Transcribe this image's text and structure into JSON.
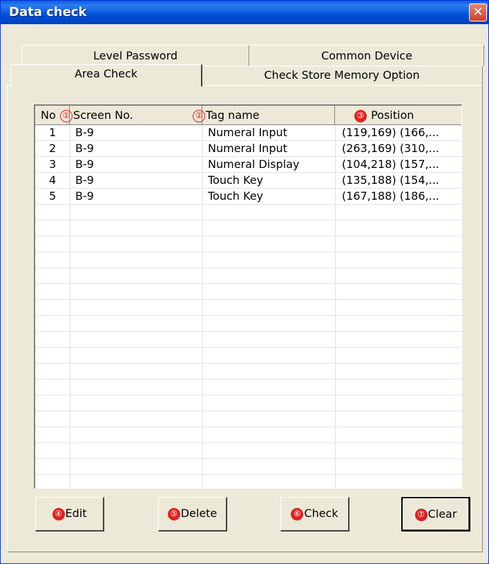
{
  "window": {
    "title": "Data check",
    "close_glyph": "✕"
  },
  "tabs": {
    "back": [
      "Level Password",
      "Common Device"
    ],
    "front": [
      "Area Check",
      "Check Store Memory Option"
    ]
  },
  "table": {
    "columns": [
      "No",
      "Screen No.",
      "Tag name",
      "Position"
    ],
    "rows": [
      [
        "1",
        "B-9",
        "Numeral Input",
        "(119,169) (166,..."
      ],
      [
        "2",
        "B-9",
        "Numeral Input",
        "(263,169) (310,..."
      ],
      [
        "3",
        "B-9",
        "Numeral Display",
        "(104,218) (157,..."
      ],
      [
        "4",
        "B-9",
        "Touch Key",
        "(135,188) (154,..."
      ],
      [
        "5",
        "B-9",
        "Touch Key",
        "(167,188) (186,..."
      ]
    ]
  },
  "markers": [
    "①",
    "②",
    "③",
    "④",
    "⑤",
    "⑥",
    "⑦"
  ],
  "buttons": {
    "edit": "Edit",
    "delete": "Delete",
    "check": "Check",
    "clear": "Clear"
  },
  "colors": {
    "marker_red": "#e02020",
    "titlebar_blue": "#0050d8",
    "close_red": "#c9412a"
  }
}
